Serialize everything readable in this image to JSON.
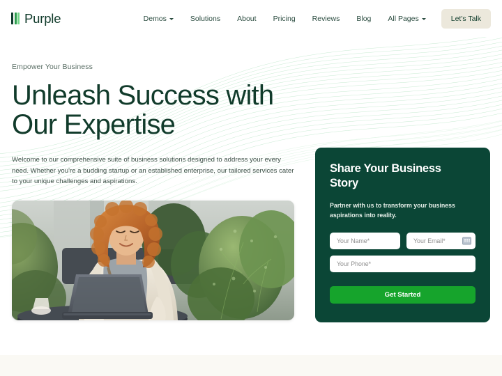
{
  "brand": {
    "name": "Purple",
    "logo_bar_colors": [
      "#0f3d2e",
      "#2f9e4f",
      "#73d689"
    ]
  },
  "header": {
    "nav_items": [
      {
        "label": "Demos",
        "has_dropdown": true
      },
      {
        "label": "Solutions",
        "has_dropdown": false
      },
      {
        "label": "About",
        "has_dropdown": false
      },
      {
        "label": "Pricing",
        "has_dropdown": false
      },
      {
        "label": "Reviews",
        "has_dropdown": false
      },
      {
        "label": "Blog",
        "has_dropdown": false
      },
      {
        "label": "All Pages",
        "has_dropdown": true
      }
    ],
    "cta_label": "Let's Talk",
    "cta_bg": "#ece8dc"
  },
  "hero": {
    "eyebrow": "Empower Your Business",
    "headline": "Unleash Success with Our Expertise",
    "paragraph": "Welcome to our comprehensive suite of business solutions designed to address your every need. Whether you're a budding startup or an established enterprise, our tailored services cater to your unique challenges and aspirations.",
    "image_alt": "Smiling woman with curly red hair working on a laptop at an outdoor cafe table surrounded by green shrubs"
  },
  "form_card": {
    "title": "Share Your Business Story",
    "subtitle": "Partner with us to transform your business aspirations into reality.",
    "bg_color": "#0b4636",
    "fields": [
      {
        "name": "name",
        "placeholder": "Your Name*",
        "value": ""
      },
      {
        "name": "email",
        "placeholder": "Your Email*",
        "value": ""
      },
      {
        "name": "phone",
        "placeholder": "Your Phone*",
        "value": ""
      }
    ],
    "submit_label": "Get Started",
    "submit_color": "#16a42c"
  },
  "bottom_section": {
    "bg_color": "#faf9f4"
  }
}
